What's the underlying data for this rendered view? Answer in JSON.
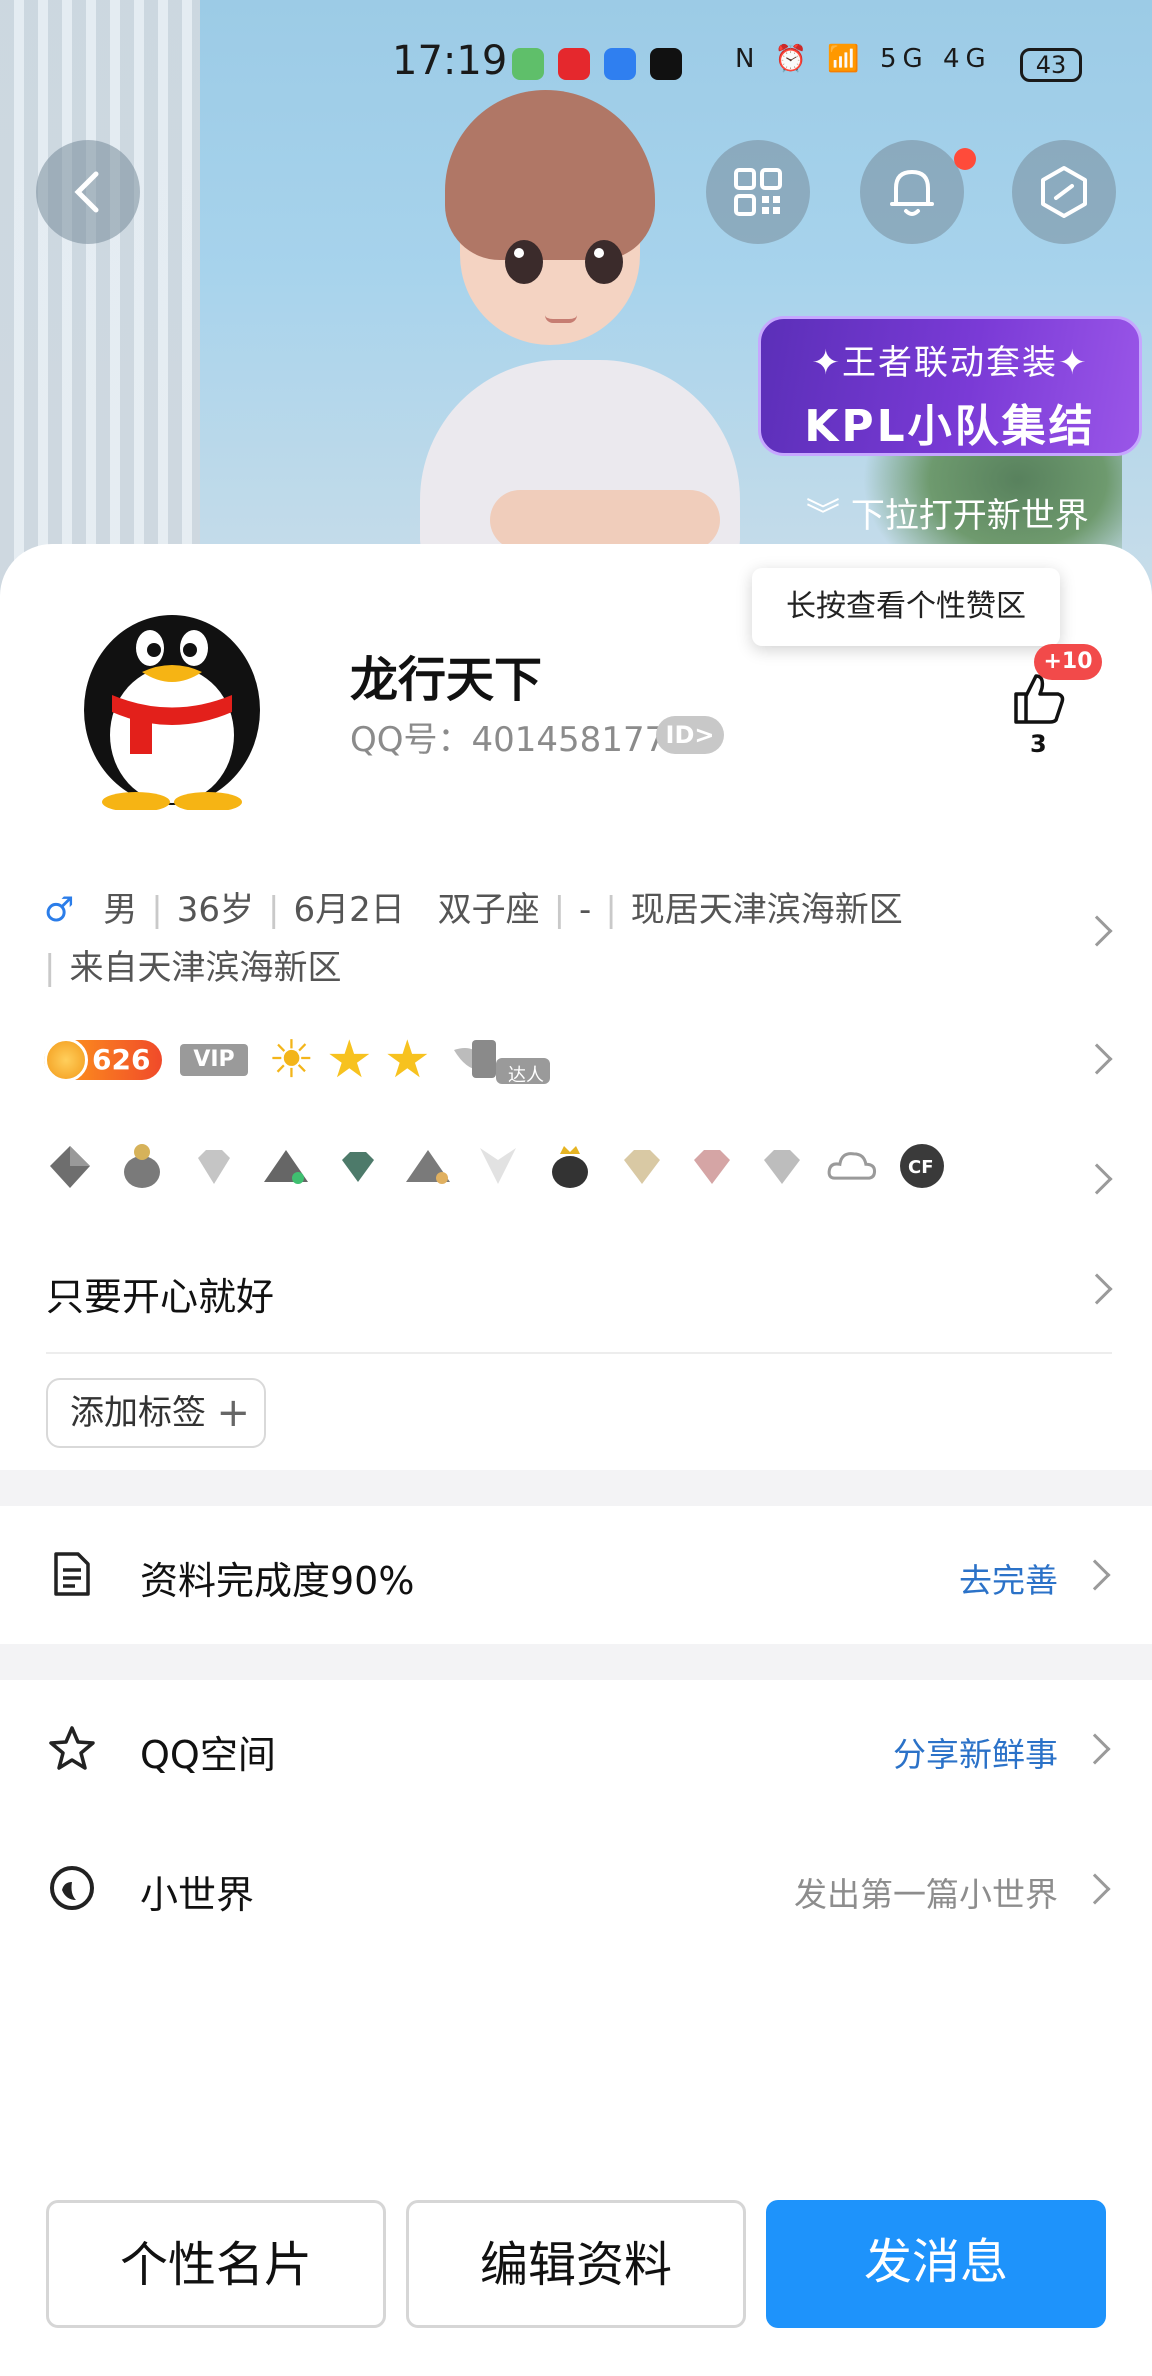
{
  "status_bar": {
    "time": "17:19",
    "network": "5G 4G",
    "battery": "43"
  },
  "hero": {
    "promo_line1": "✦王者联动套装✦",
    "promo_line2": "KPL小队集结",
    "pull_hint": "下拉打开新世界"
  },
  "profile": {
    "nickname": "龙行天下",
    "qq_label": "QQ号：401458177",
    "id_badge": "ID>",
    "tooltip": "长按查看个性赞区",
    "like_plus": "+10",
    "like_count": "3",
    "gender_symbol": "♂",
    "gender": "男",
    "age": "36岁",
    "birthday": "6月2日",
    "zodiac": "双子座",
    "dash": "-",
    "location": "现居天津滨海新区",
    "hometown": "来自天津滨海新区",
    "level": "626",
    "vip": "VIP",
    "daren": "达人",
    "signature": "只要开心就好",
    "add_tag": "添加标签"
  },
  "rows": {
    "completion_label": "资料完成度90%",
    "completion_action": "去完善",
    "qzone_label": "QQ空间",
    "qzone_action": "分享新鲜事",
    "world_label": "小世界",
    "world_action": "发出第一篇小世界"
  },
  "buttons": {
    "card": "个性名片",
    "edit": "编辑资料",
    "message": "发消息"
  },
  "colors": {
    "primary": "#1e93fb",
    "link": "#2b72c8",
    "like_badge": "#f24a4a"
  }
}
